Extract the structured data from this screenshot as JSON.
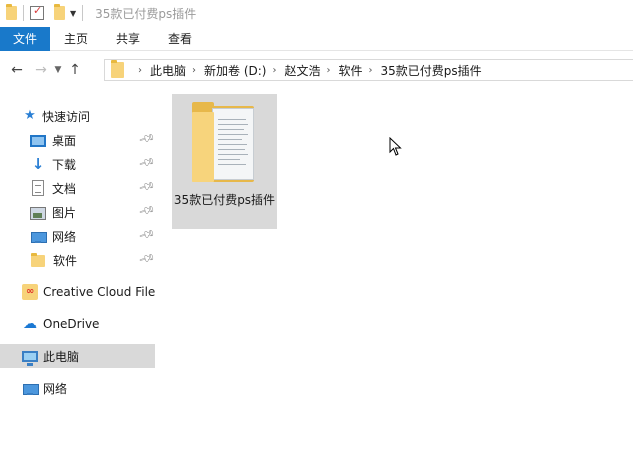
{
  "window": {
    "title": "35款已付费ps插件"
  },
  "ribbon": {
    "tabs": [
      {
        "label": "文件",
        "active": true
      },
      {
        "label": "主页"
      },
      {
        "label": "共享"
      },
      {
        "label": "查看"
      }
    ]
  },
  "address": {
    "crumbs": [
      "此电脑",
      "新加卷 (D:)",
      "赵文浩",
      "软件",
      "35款已付费ps插件"
    ]
  },
  "nav_pane": {
    "quick_access": {
      "label": "快速访问",
      "icon": "star-icon"
    },
    "pinned": [
      {
        "label": "桌面",
        "icon": "desktop-icon"
      },
      {
        "label": "下载",
        "icon": "download-icon"
      },
      {
        "label": "文档",
        "icon": "document-icon"
      },
      {
        "label": "图片",
        "icon": "pictures-icon"
      },
      {
        "label": "网络",
        "icon": "network-icon"
      },
      {
        "label": "软件",
        "icon": "folder-icon"
      }
    ],
    "roots": [
      {
        "label": "Creative Cloud Files",
        "icon": "creative-cloud-icon"
      },
      {
        "label": "OneDrive",
        "icon": "onedrive-icon"
      },
      {
        "label": "此电脑",
        "icon": "this-pc-icon",
        "selected": true
      },
      {
        "label": "网络",
        "icon": "network-icon"
      }
    ]
  },
  "content": {
    "items": [
      {
        "name": "35款已付费ps插件",
        "type": "folder",
        "selected": true
      }
    ]
  },
  "colors": {
    "accent": "#1979ca",
    "selection": "#d9d9d9",
    "folder": "#f7d37a"
  }
}
